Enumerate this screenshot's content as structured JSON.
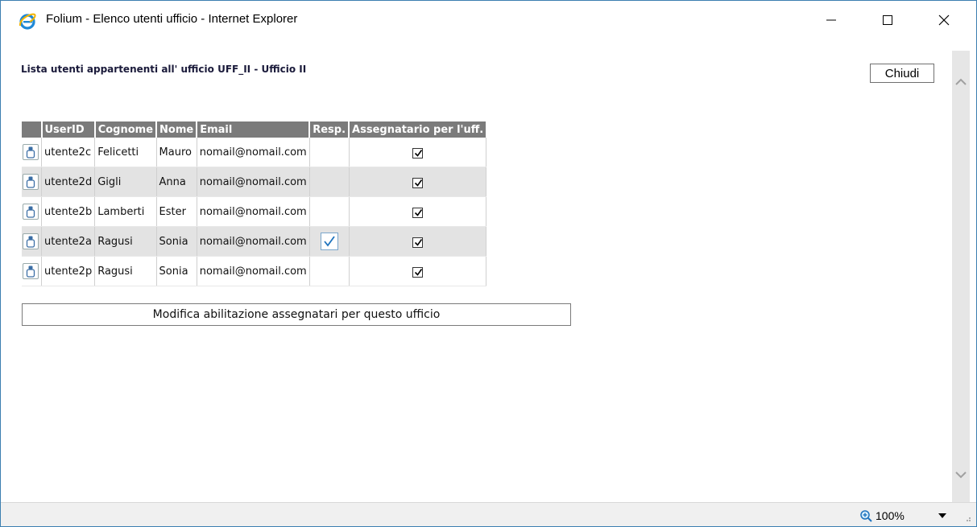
{
  "window": {
    "title": "Folium - Elenco utenti ufficio - Internet Explorer"
  },
  "page": {
    "heading": "Lista utenti appartenenti all' ufficio UFF_II - Ufficio II",
    "close_label": "Chiudi",
    "modify_label": "Modifica abilitazione assegnatari per questo ufficio"
  },
  "table": {
    "headers": [
      "UserID",
      "Cognome",
      "Nome",
      "Email",
      "Resp.",
      "Assegnatario per l'uff."
    ],
    "rows": [
      {
        "userid": "utente2c",
        "cognome": "Felicetti",
        "nome": "Mauro",
        "email": "nomail@nomail.com",
        "resp": false,
        "assegnatario": true
      },
      {
        "userid": "utente2d",
        "cognome": "Gigli",
        "nome": "Anna",
        "email": "nomail@nomail.com",
        "resp": false,
        "assegnatario": true
      },
      {
        "userid": "utente2b",
        "cognome": "Lamberti",
        "nome": "Ester",
        "email": "nomail@nomail.com",
        "resp": false,
        "assegnatario": true
      },
      {
        "userid": "utente2a",
        "cognome": "Ragusi",
        "nome": "Sonia",
        "email": "nomail@nomail.com",
        "resp": true,
        "assegnatario": true
      },
      {
        "userid": "utente2p",
        "cognome": "Ragusi",
        "nome": "Sonia",
        "email": "nomail@nomail.com",
        "resp": false,
        "assegnatario": true
      }
    ]
  },
  "statusbar": {
    "zoom": "100%"
  },
  "icons": {
    "app": "internet-explorer-icon",
    "user": "user-icon",
    "zoom": "zoom-in-icon"
  },
  "colors": {
    "header_bg": "#7b7b7b",
    "alt_row": "#e3e3e3",
    "accent": "#1e73be"
  }
}
